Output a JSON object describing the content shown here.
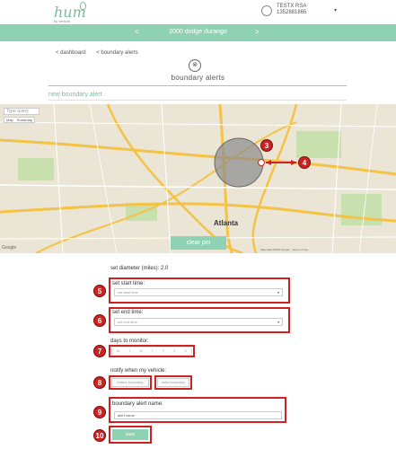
{
  "header": {
    "logo": "hum",
    "logo_sub": "by verizon",
    "user_name": "TESTX RSA",
    "user_phone": "1352881865"
  },
  "vehicle_bar": {
    "prev": "<",
    "title": "2000 dodge durango",
    "next": ">"
  },
  "breadcrumb": {
    "item1": "< dashboard",
    "item2": "< boundary alerts"
  },
  "page": {
    "title": "boundary alerts",
    "section_title": "new boundary alert"
  },
  "map": {
    "search_placeholder": "Type query",
    "type_map": "Map",
    "type_satellite": "Roadmap",
    "city": "Atlanta",
    "google": "Google",
    "credit": "Map data ©2015 Google · Terms of Use",
    "clear_pin": "clear pin",
    "circle_color": "#8c8c8c"
  },
  "form": {
    "diameter_label": "set diameter (miles): 2.0",
    "start_label": "set start time:",
    "start_placeholder": "set start time",
    "end_label": "set end time:",
    "end_placeholder": "set end time",
    "days_label": "days to monitor:",
    "days": [
      "M",
      "T",
      "W",
      "T",
      "F",
      "S",
      "S"
    ],
    "notify_label": "notify when my vehicle:",
    "notify_enter": "enters boundary",
    "notify_exit": "exits boundary",
    "name_label": "boundary alert name:",
    "name_value": "alert name",
    "save": "save"
  },
  "annotations": [
    "3",
    "4",
    "5",
    "6",
    "7",
    "8",
    "9",
    "10"
  ],
  "colors": {
    "accent": "#8fd2b3",
    "highlight": "#cc2222"
  }
}
